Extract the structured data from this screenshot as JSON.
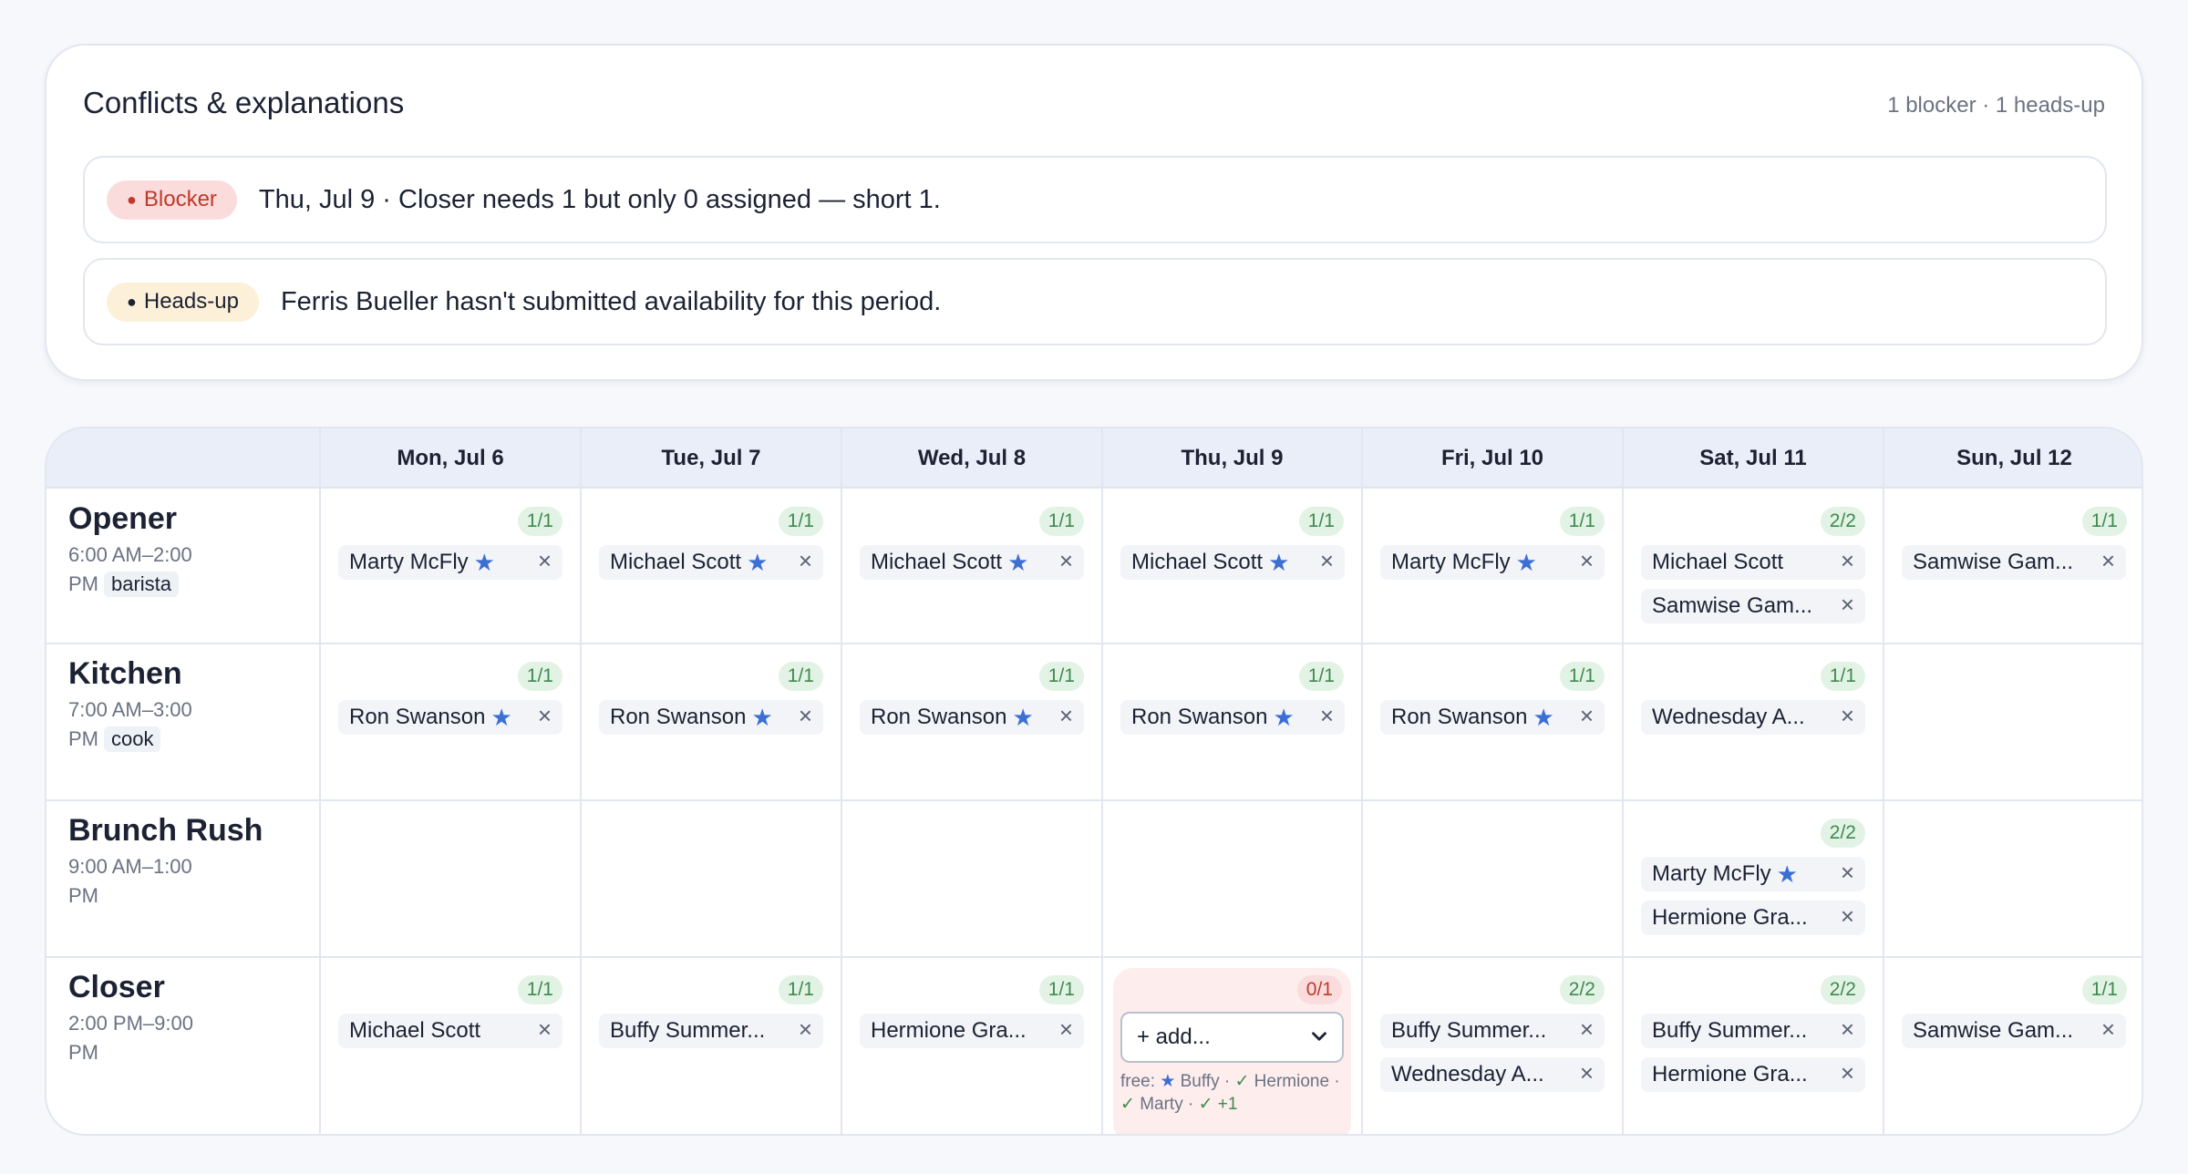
{
  "conflicts": {
    "title": "Conflicts & explanations",
    "summary": "1 blocker · 1 heads-up",
    "items": [
      {
        "type": "Blocker",
        "message": "Thu, Jul 9 · Closer needs 1 but only 0 assigned — short 1."
      },
      {
        "type": "Heads-up",
        "message": "Ferris Bueller hasn't submitted availability for this period."
      }
    ]
  },
  "days": [
    "Mon, Jul 6",
    "Tue, Jul 7",
    "Wed, Jul 8",
    "Thu, Jul 9",
    "Fri, Jul 10",
    "Sat, Jul 11",
    "Sun, Jul 12"
  ],
  "shifts": [
    {
      "name": "Opener",
      "time": "6:00 AM–2:00 PM",
      "role": "barista"
    },
    {
      "name": "Kitchen",
      "time": "7:00 AM–3:00 PM",
      "role": "cook"
    },
    {
      "name": "Brunch Rush",
      "time": "9:00 AM–1:00 PM",
      "role": ""
    },
    {
      "name": "Closer",
      "time": "2:00 PM–9:00 PM",
      "role": ""
    }
  ],
  "cells": {
    "opener": {
      "mon": {
        "count": "1/1",
        "people": [
          {
            "name": "Marty McFly",
            "star": true
          }
        ]
      },
      "tue": {
        "count": "1/1",
        "people": [
          {
            "name": "Michael Scott",
            "star": true
          }
        ]
      },
      "wed": {
        "count": "1/1",
        "people": [
          {
            "name": "Michael Scott",
            "star": true
          }
        ]
      },
      "thu": {
        "count": "1/1",
        "people": [
          {
            "name": "Michael Scott",
            "star": true
          }
        ]
      },
      "fri": {
        "count": "1/1",
        "people": [
          {
            "name": "Marty McFly",
            "star": true
          }
        ]
      },
      "sat": {
        "count": "2/2",
        "people": [
          {
            "name": "Michael Scott",
            "star": false
          },
          {
            "name": "Samwise Gam...",
            "star": false
          }
        ]
      },
      "sun": {
        "count": "1/1",
        "people": [
          {
            "name": "Samwise Gam...",
            "star": false
          }
        ]
      }
    },
    "kitchen": {
      "mon": {
        "count": "1/1",
        "people": [
          {
            "name": "Ron Swanson",
            "star": true
          }
        ]
      },
      "tue": {
        "count": "1/1",
        "people": [
          {
            "name": "Ron Swanson",
            "star": true
          }
        ]
      },
      "wed": {
        "count": "1/1",
        "people": [
          {
            "name": "Ron Swanson",
            "star": true
          }
        ]
      },
      "thu": {
        "count": "1/1",
        "people": [
          {
            "name": "Ron Swanson",
            "star": true
          }
        ]
      },
      "fri": {
        "count": "1/1",
        "people": [
          {
            "name": "Ron Swanson",
            "star": true
          }
        ]
      },
      "sat": {
        "count": "1/1",
        "people": [
          {
            "name": "Wednesday A...",
            "star": false
          }
        ]
      }
    },
    "brunch": {
      "sat": {
        "count": "2/2",
        "people": [
          {
            "name": "Marty McFly",
            "star": true
          },
          {
            "name": "Hermione Gra...",
            "star": false
          }
        ]
      }
    },
    "closer": {
      "mon": {
        "count": "1/1",
        "people": [
          {
            "name": "Michael Scott",
            "star": false
          }
        ]
      },
      "tue": {
        "count": "1/1",
        "people": [
          {
            "name": "Buffy Summer...",
            "star": false
          }
        ]
      },
      "wed": {
        "count": "1/1",
        "people": [
          {
            "name": "Hermione Gra...",
            "star": false
          }
        ]
      },
      "thu": {
        "count": "0/1",
        "add_label": "+ add...",
        "free_label": "free:",
        "free": [
          "Buffy",
          "Hermione",
          "Marty"
        ],
        "more": "+1"
      },
      "fri": {
        "count": "2/2",
        "people": [
          {
            "name": "Buffy Summer...",
            "star": false
          },
          {
            "name": "Wednesday A...",
            "star": false
          }
        ]
      },
      "sat": {
        "count": "2/2",
        "people": [
          {
            "name": "Buffy Summer...",
            "star": false
          },
          {
            "name": "Hermione Gra...",
            "star": false
          }
        ]
      },
      "sun": {
        "count": "1/1",
        "people": [
          {
            "name": "Samwise Gam...",
            "star": false
          }
        ]
      }
    }
  },
  "icons": {
    "star": "star-icon",
    "remove": "close-icon",
    "caret": "chevron-down-icon"
  },
  "colors": {
    "accent_star": "#3b6fd4",
    "ok_badge": "#e2f3e5",
    "bad_badge": "#fbdcdc",
    "header_bg": "#e9eef8"
  }
}
